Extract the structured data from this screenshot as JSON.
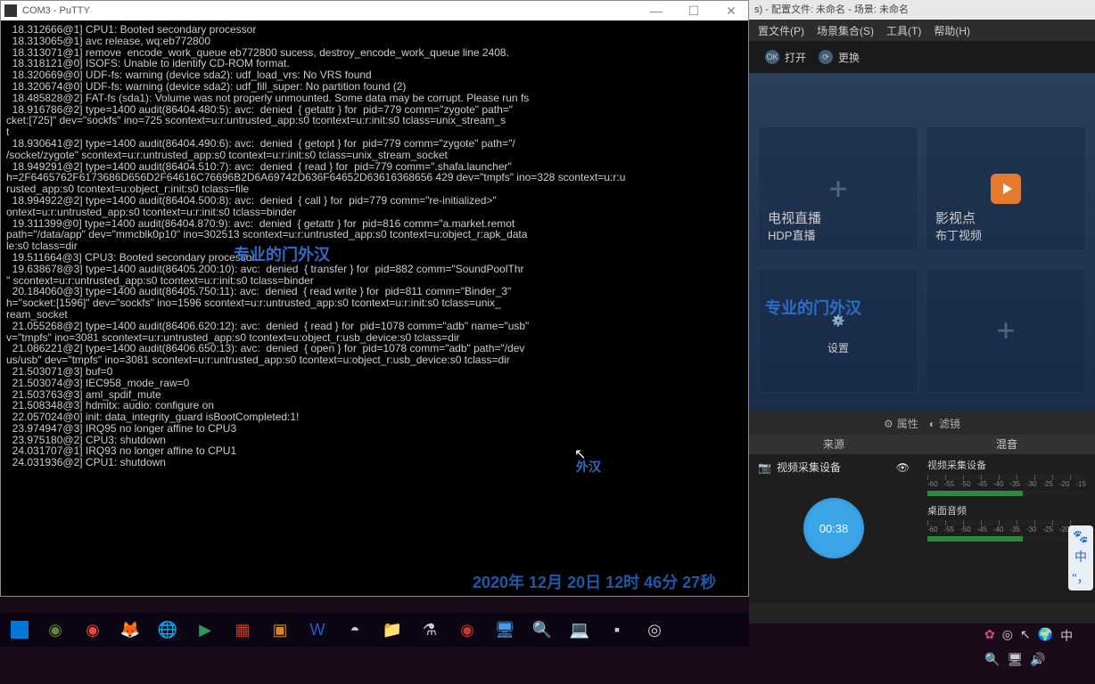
{
  "putty": {
    "title": "COM3 - PuTTY",
    "lines": [
      "  18.312666@1] CPU1: Booted secondary processor",
      "  18.313065@1] avc release, wq:eb772800",
      "  18.313071@1] remove  encode_work_queue eb772800 sucess, destroy_encode_work_queue line 2408.",
      "  18.318121@0] ISOFS: Unable to identify CD-ROM format.",
      "  18.320669@0] UDF-fs: warning (device sda2): udf_load_vrs: No VRS found",
      "  18.320674@0] UDF-fs: warning (device sda2): udf_fill_super: No partition found (2)",
      "  18.485828@2] FAT-fs (sda1): Volume was not properly unmounted. Some data may be corrupt. Please run fs",
      "",
      "  18.916786@2] type=1400 audit(86404.480:5): avc:  denied  { getattr } for  pid=779 comm=\"zygote\" path=\"",
      "cket:[725]\" dev=\"sockfs\" ino=725 scontext=u:r:untrusted_app:s0 tcontext=u:r:init:s0 tclass=unix_stream_s",
      "t",
      "  18.930641@2] type=1400 audit(86404.490:6): avc:  denied  { getopt } for  pid=779 comm=\"zygote\" path=\"/",
      "/socket/zygote\" scontext=u:r:untrusted_app:s0 tcontext=u:r:init:s0 tclass=unix_stream_socket",
      "  18.949291@2] type=1400 audit(86404.510:7): avc:  denied  { read } for  pid=779 comm=\".shafa.launcher\"",
      "h=2F6465762F6173686D656D2F64616C76696B2D6A69742D636F64652D63616368656 429 dev=\"tmpfs\" ino=328 scontext=u:r:u",
      "rusted_app:s0 tcontext=u:object_r:init:s0 tclass=file",
      "  18.994922@2] type=1400 audit(86404.500:8): avc:  denied  { call } for  pid=779 comm=\"re-initialized>\"",
      "ontext=u:r:untrusted_app:s0 tcontext=u:r:init:s0 tclass=binder",
      "  19.311399@0] type=1400 audit(86404.870:9): avc:  denied  { getattr } for  pid=816 comm=\"a.market.remot",
      "path=\"/data/app\" dev=\"mmcblk0p10\" ino=302513 scontext=u:r:untrusted_app:s0 tcontext=u:object_r:apk_data",
      "le:s0 tclass=dir",
      "  19.511664@3] CPU3: Booted secondary processor",
      "  19.638678@3] type=1400 audit(86405.200:10): avc:  denied  { transfer } for  pid=882 comm=\"SoundPoolThr",
      "\" scontext=u:r:untrusted_app:s0 tcontext=u:r:init:s0 tclass=binder",
      "  20.184060@3] type=1400 audit(86405.750:11): avc:  denied  { read write } for  pid=811 comm=\"Binder_3\"",
      "h=\"socket:[1596]\" dev=\"sockfs\" ino=1596 scontext=u:r:untrusted_app:s0 tcontext=u:r:init:s0 tclass=unix_",
      "ream_socket",
      "  21.055268@2] type=1400 audit(86406.620:12): avc:  denied  { read } for  pid=1078 comm=\"adb\" name=\"usb\"",
      "v=\"tmpfs\" ino=3081 scontext=u:r:untrusted_app:s0 tcontext=u:object_r:usb_device:s0 tclass=dir",
      "  21.086221@2] type=1400 audit(86406.650:13): avc:  denied  { open } for  pid=1078 comm=\"adb\" path=\"/dev",
      "us/usb\" dev=\"tmpfs\" ino=3081 scontext=u:r:untrusted_app:s0 tcontext=u:object_r:usb_device:s0 tclass=dir",
      "  21.503071@3] buf=0",
      "  21.503074@3] IEC958_mode_raw=0",
      "  21.503763@3] aml_spdif_mute",
      "  21.508348@3] hdmitx: audio: configure on",
      "  22.057024@0] init: data_integrity_guard isBootCompleted:1!",
      "  23.974947@3] IRQ95 no longer affine to CPU3",
      "  23.975180@2] CPU3: shutdown",
      "  24.031707@1] IRQ93 no longer affine to CPU1",
      "  24.031936@2] CPU1: shutdown"
    ]
  },
  "obs": {
    "title": "s) - 配置文件: 未命名 - 场景: 未命名",
    "menu": {
      "scene_file": "置文件(P)",
      "scene_set": "场景集合(S)",
      "tools": "工具(T)",
      "help": "帮助(H)"
    },
    "toolbar": {
      "open": "打开",
      "replace": "更换"
    },
    "tiles": {
      "tv_main": "电视直播",
      "tv_sub": "HDP直播",
      "movie_main": "影视点",
      "movie_sub": "布丁视频",
      "settings": "设置"
    },
    "midbar": {
      "attrs": "属性",
      "filter": "滤镜"
    },
    "source": {
      "header": "来源",
      "item": "视频采集设备",
      "timer": "00:38"
    },
    "mixer": {
      "header": "混音",
      "video_src": "视频采集设备",
      "desktop_audio": "桌面音频",
      "ticks": [
        "-60",
        "-55",
        "-50",
        "-45",
        "-40",
        "-35",
        "-30",
        "-25",
        "-20",
        "-15"
      ]
    }
  },
  "watermarks": {
    "wm1": "专业的门外汉",
    "wm2": "专业的门外汉",
    "wm3": "外汉"
  },
  "timestamp": "2020年 12月 20日 12时 46分 27秒",
  "ime": "中"
}
